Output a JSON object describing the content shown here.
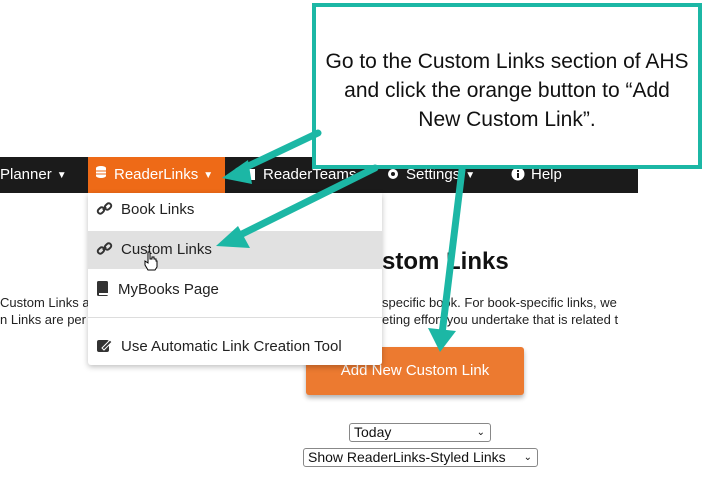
{
  "nav": {
    "planner_label": "Planner",
    "readerlinks_label": "ReaderLinks",
    "readerteams_label": "ReaderTeams",
    "settings_label": "Settings",
    "help_label": "Help"
  },
  "dropdown": {
    "items": [
      {
        "label": "Book Links",
        "icon": "link-icon"
      },
      {
        "label": "Custom Links",
        "icon": "link-icon"
      },
      {
        "label": "MyBooks Page",
        "icon": "book-icon"
      },
      {
        "label": "Use Automatic Link Creation Tool",
        "icon": "edit-icon"
      }
    ]
  },
  "main": {
    "title_partial": "stom Links",
    "line1_left": "Custom Links a",
    "line1_right": "specific book. For book-specific links, we",
    "line2_left": "n Links are per",
    "line2_right": "eting effort you undertake that is related t",
    "add_button_label": "Add New Custom Link",
    "date_filter": "Today",
    "style_filter": "Show ReaderLinks-Styled Links"
  },
  "callout": {
    "text": "Go to the Custom Links section of AHS and click the orange button to “Add New Custom Link”."
  },
  "colors": {
    "accent": "#ee6a17",
    "button": "#ec7a30",
    "callout_border": "#1cb7a5",
    "navbar": "#1b1b1b"
  }
}
